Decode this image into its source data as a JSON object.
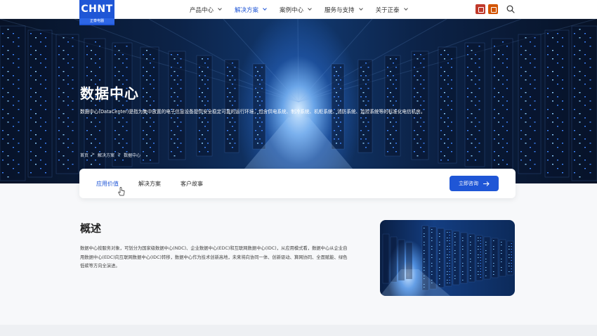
{
  "brand": {
    "logo_text": "CHNT",
    "logo_sub": "正泰电器",
    "color": "#1f56d6"
  },
  "nav": {
    "items": [
      {
        "label": "产品中心",
        "active": false
      },
      {
        "label": "解决方案",
        "active": true
      },
      {
        "label": "案例中心",
        "active": false
      },
      {
        "label": "服务与支持",
        "active": false
      },
      {
        "label": "关于正泰",
        "active": false
      }
    ]
  },
  "hero": {
    "title": "数据中心",
    "description": "数据中心(DataCenter)是指为集中放置的电子信息设备提供安全稳定可靠的运行环境，包含供电系统、制冷系统、机柜系统、消防系统、监控系统等的标准化电信机房。",
    "breadcrumb": [
      "首页",
      ">",
      "解决方案",
      ">",
      "数据中心"
    ]
  },
  "tabs": {
    "items": [
      {
        "label": "应用价值",
        "active": true
      },
      {
        "label": "解决方案",
        "active": false
      },
      {
        "label": "客户故事",
        "active": false
      }
    ],
    "cta_label": "立即咨询"
  },
  "overview": {
    "title": "概述",
    "text": "数据中心按服务对象，可划分为国家级数据中心(NDC)、企业数据中心(EDC)和互联网数据中心(IDC)，从应用模式看，数据中心从企业自用数据中心(EDC)向互联网数据中心(IDC)转移，数据中心作为技术创新高地，未来将向协同一体、创新驱动、算网协同、全面赋能、绿色低碳等方向全演进。"
  }
}
